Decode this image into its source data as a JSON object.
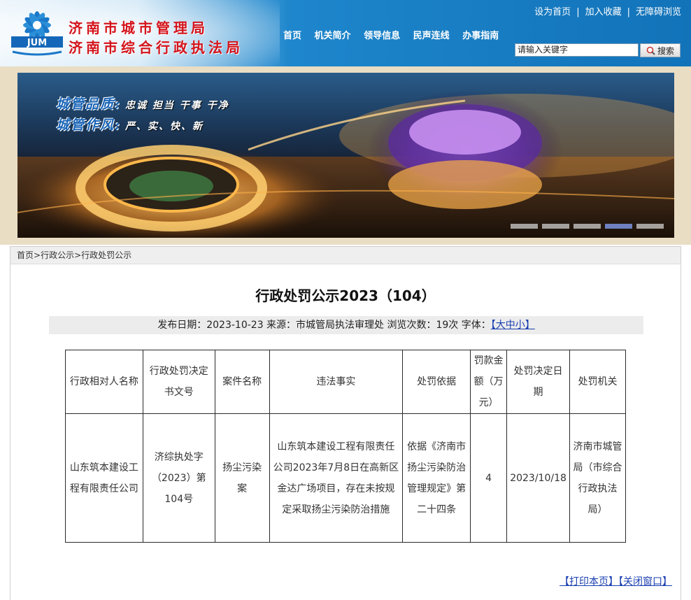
{
  "header": {
    "org_names": [
      "济南市城市管理局",
      "济南市综合行政执法局"
    ],
    "logo_text": "JUM",
    "top_links": [
      "设为首页",
      "加入收藏",
      "无障碍浏览"
    ],
    "nav": [
      "首页",
      "机关简介",
      "领导信息",
      "民声连线",
      "办事指南"
    ],
    "search_placeholder": "请输入关键字",
    "search_button": "搜索"
  },
  "banner": {
    "slogans": [
      {
        "key": "城管品质:",
        "value": "忠诚  担当  干事  干净"
      },
      {
        "key": "城管作风:",
        "value": "严、实、快、新"
      }
    ],
    "slide_count": 5,
    "active_slide": 4
  },
  "breadcrumb": [
    "首页",
    "行政公示",
    "行政处罚公示"
  ],
  "breadcrumb_sep": ">",
  "article": {
    "title": "行政处罚公示2023（104）",
    "meta_prefix": "发布日期：2023-10-23 来源：市城管局执法审理处 浏览次数：19次 字体：",
    "font_size_label": "【大中小】"
  },
  "table": {
    "headers": [
      "行政相对人名称",
      "行政处罚决定书文号",
      "案件名称",
      "违法事实",
      "处罚依据",
      "罚款金额（万元）",
      "处罚决定日期",
      "处罚机关"
    ],
    "rows": [
      [
        "山东筑本建设工程有限责任公司",
        "济综执处字（2023）第104号",
        "扬尘污染案",
        "山东筑本建设工程有限责任公司2023年7月8日在高新区金达广场项目，存在未按规定采取扬尘污染防治措施",
        "依据《济南市扬尘污染防治管理规定》第二十四条",
        "4",
        "2023/10/18",
        "济南市城管局（市综合行政执法局）"
      ]
    ]
  },
  "footer_links": [
    "【打印本页】",
    "【关闭窗口】"
  ],
  "colors": {
    "org_name": "#d4141c",
    "header_blue": "#1273b9",
    "link_blue": "#1a3fb0"
  }
}
